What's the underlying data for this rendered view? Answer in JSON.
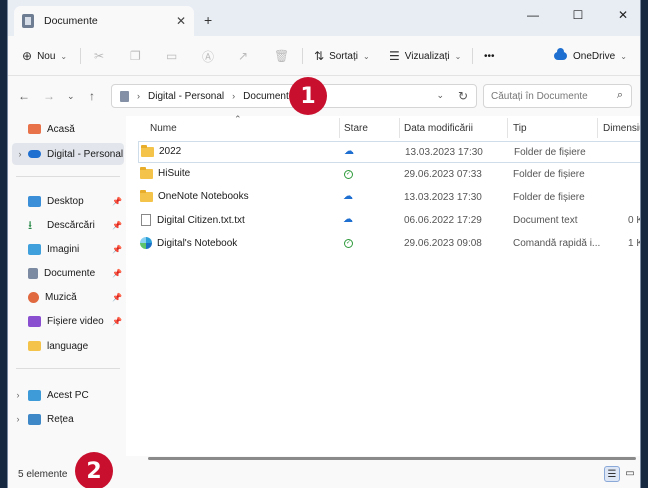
{
  "window": {
    "tab_title": "Documente",
    "tab_close": "✕",
    "new_tab": "+",
    "min": "—",
    "max": "☐",
    "close": "✕"
  },
  "toolbar": {
    "new_label": "Nou",
    "sort_label": "Sortați",
    "view_label": "Vizualizați",
    "more_label": "•••",
    "onedrive_label": "OneDrive"
  },
  "address": {
    "crumbs": [
      "Digital - Personal",
      "Documente"
    ],
    "search_placeholder": "Căutați în Documente"
  },
  "sidebar": {
    "items": [
      {
        "label": "Acasă"
      },
      {
        "label": "Digital - Personal"
      },
      {
        "label": "Desktop"
      },
      {
        "label": "Descărcări"
      },
      {
        "label": "Imagini"
      },
      {
        "label": "Documente"
      },
      {
        "label": "Muzică"
      },
      {
        "label": "Fișiere video"
      },
      {
        "label": "language"
      },
      {
        "label": "Acest PC"
      },
      {
        "label": "Rețea"
      }
    ]
  },
  "columns": {
    "name": "Nume",
    "status": "Stare",
    "date": "Data modificării",
    "type": "Tip",
    "size": "Dimensiune"
  },
  "files": [
    {
      "name": "2022",
      "status": "cloud",
      "date": "13.03.2023 17:30",
      "type": "Folder de fișiere",
      "size": ""
    },
    {
      "name": "HiSuite",
      "status": "synced",
      "date": "29.06.2023 07:33",
      "type": "Folder de fișiere",
      "size": ""
    },
    {
      "name": "OneNote Notebooks",
      "status": "cloud",
      "date": "13.03.2023 17:30",
      "type": "Folder de fișiere",
      "size": ""
    },
    {
      "name": "Digital Citizen.txt.txt",
      "status": "cloud",
      "date": "06.06.2022 17:29",
      "type": "Document text",
      "size": "0 K"
    },
    {
      "name": "Digital's Notebook",
      "status": "synced",
      "date": "29.06.2023 09:08",
      "type": "Comandă rapidă i...",
      "size": "1 K"
    }
  ],
  "status": {
    "count": "5 elemente"
  },
  "callouts": {
    "one": "1",
    "two": "2"
  }
}
